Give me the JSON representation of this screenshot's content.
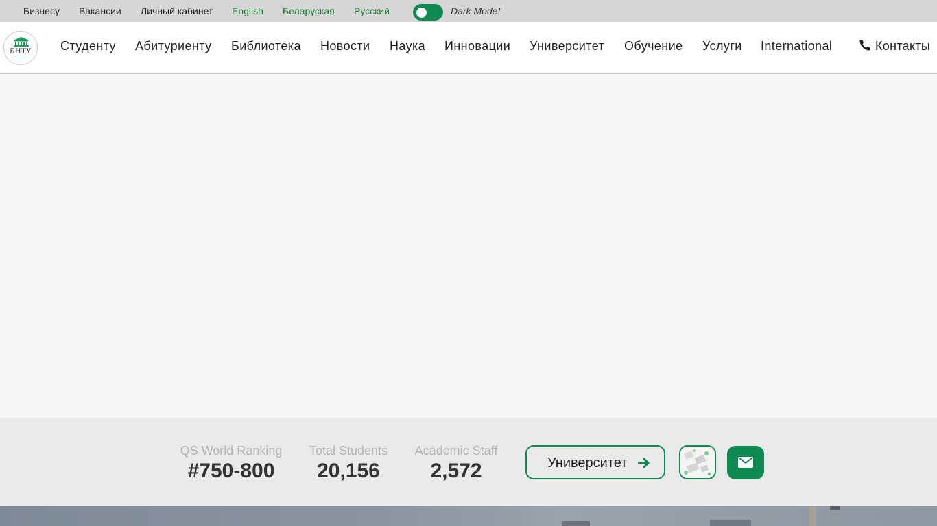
{
  "topbar": {
    "links": [
      "Бизнесу",
      "Вакансии",
      "Личный кабинет"
    ],
    "languages": [
      "English",
      "Беларуская",
      "Русский"
    ],
    "dark_mode_label": "Dark Mode!"
  },
  "logo": {
    "text": "БНТУ"
  },
  "nav": {
    "items": [
      "Студенту",
      "Абитуриенту",
      "Библиотека",
      "Новости",
      "Наука",
      "Инновации",
      "Университет",
      "Обучение",
      "Услуги",
      "International"
    ],
    "contacts_label": "Контакты"
  },
  "stats": [
    {
      "label": "QS World Ranking",
      "value": "#750-800"
    },
    {
      "label": "Total Students",
      "value": "20,156"
    },
    {
      "label": "Academic Staff",
      "value": "2,572"
    }
  ],
  "actions": {
    "university_button": "Университет"
  },
  "colors": {
    "accent": "#0e8a52",
    "language_link": "#1f7a32",
    "topbar_bg": "#d6d6d6",
    "stats_bg": "#eaeaea"
  },
  "icons": [
    "phone-icon",
    "arrow-right-icon",
    "envelope-icon",
    "university-building-icon"
  ]
}
